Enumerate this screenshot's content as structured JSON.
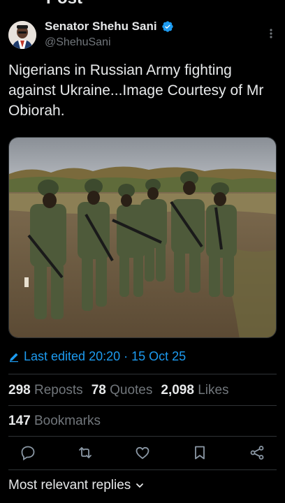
{
  "page": {
    "title_partial": "Post"
  },
  "author": {
    "name": "Senator Shehu Sani",
    "handle": "@ShehuSani",
    "verified": true
  },
  "tweet": {
    "text": "Nigerians in Russian Army fighting against Ukraine...Image Courtesy of Mr Obiorah.",
    "media_icon": "photo-of-soldiers"
  },
  "edit_info": {
    "label": "Last edited 20:20 · 15 Oct 25"
  },
  "stats": {
    "reposts_count": "298",
    "reposts_label": "Reposts",
    "quotes_count": "78",
    "quotes_label": "Quotes",
    "likes_count": "2,098",
    "likes_label": "Likes",
    "bookmarks_count": "147",
    "bookmarks_label": "Bookmarks"
  },
  "actions": [
    "reply-icon",
    "repost-icon",
    "like-icon",
    "bookmark-icon",
    "share-icon"
  ],
  "replies_sort": {
    "label": "Most relevant replies"
  },
  "colors": {
    "background": "#000000",
    "text": "#e7e9ea",
    "muted": "#71767b",
    "accent": "#1d9bf0",
    "divider": "#2f3336"
  }
}
